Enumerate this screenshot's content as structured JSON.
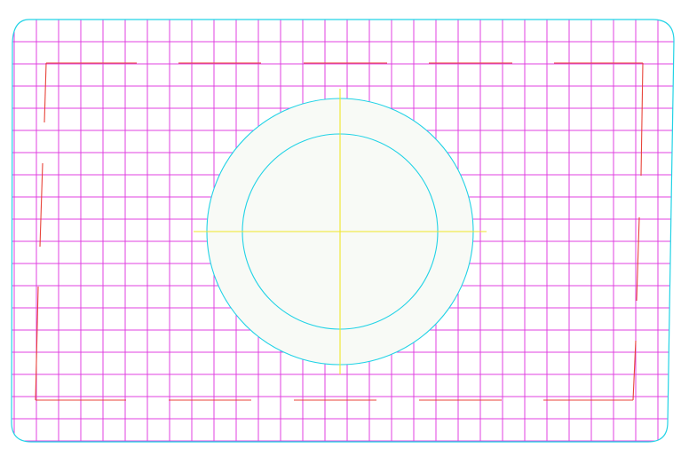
{
  "drawing": {
    "grid_color": "#e040e0",
    "outline_color": "#22d3e6",
    "dash_color": "#e8443a",
    "centerline_color": "#f0e628",
    "disc_fill": "#f8faf6",
    "background": "#ffffff"
  }
}
